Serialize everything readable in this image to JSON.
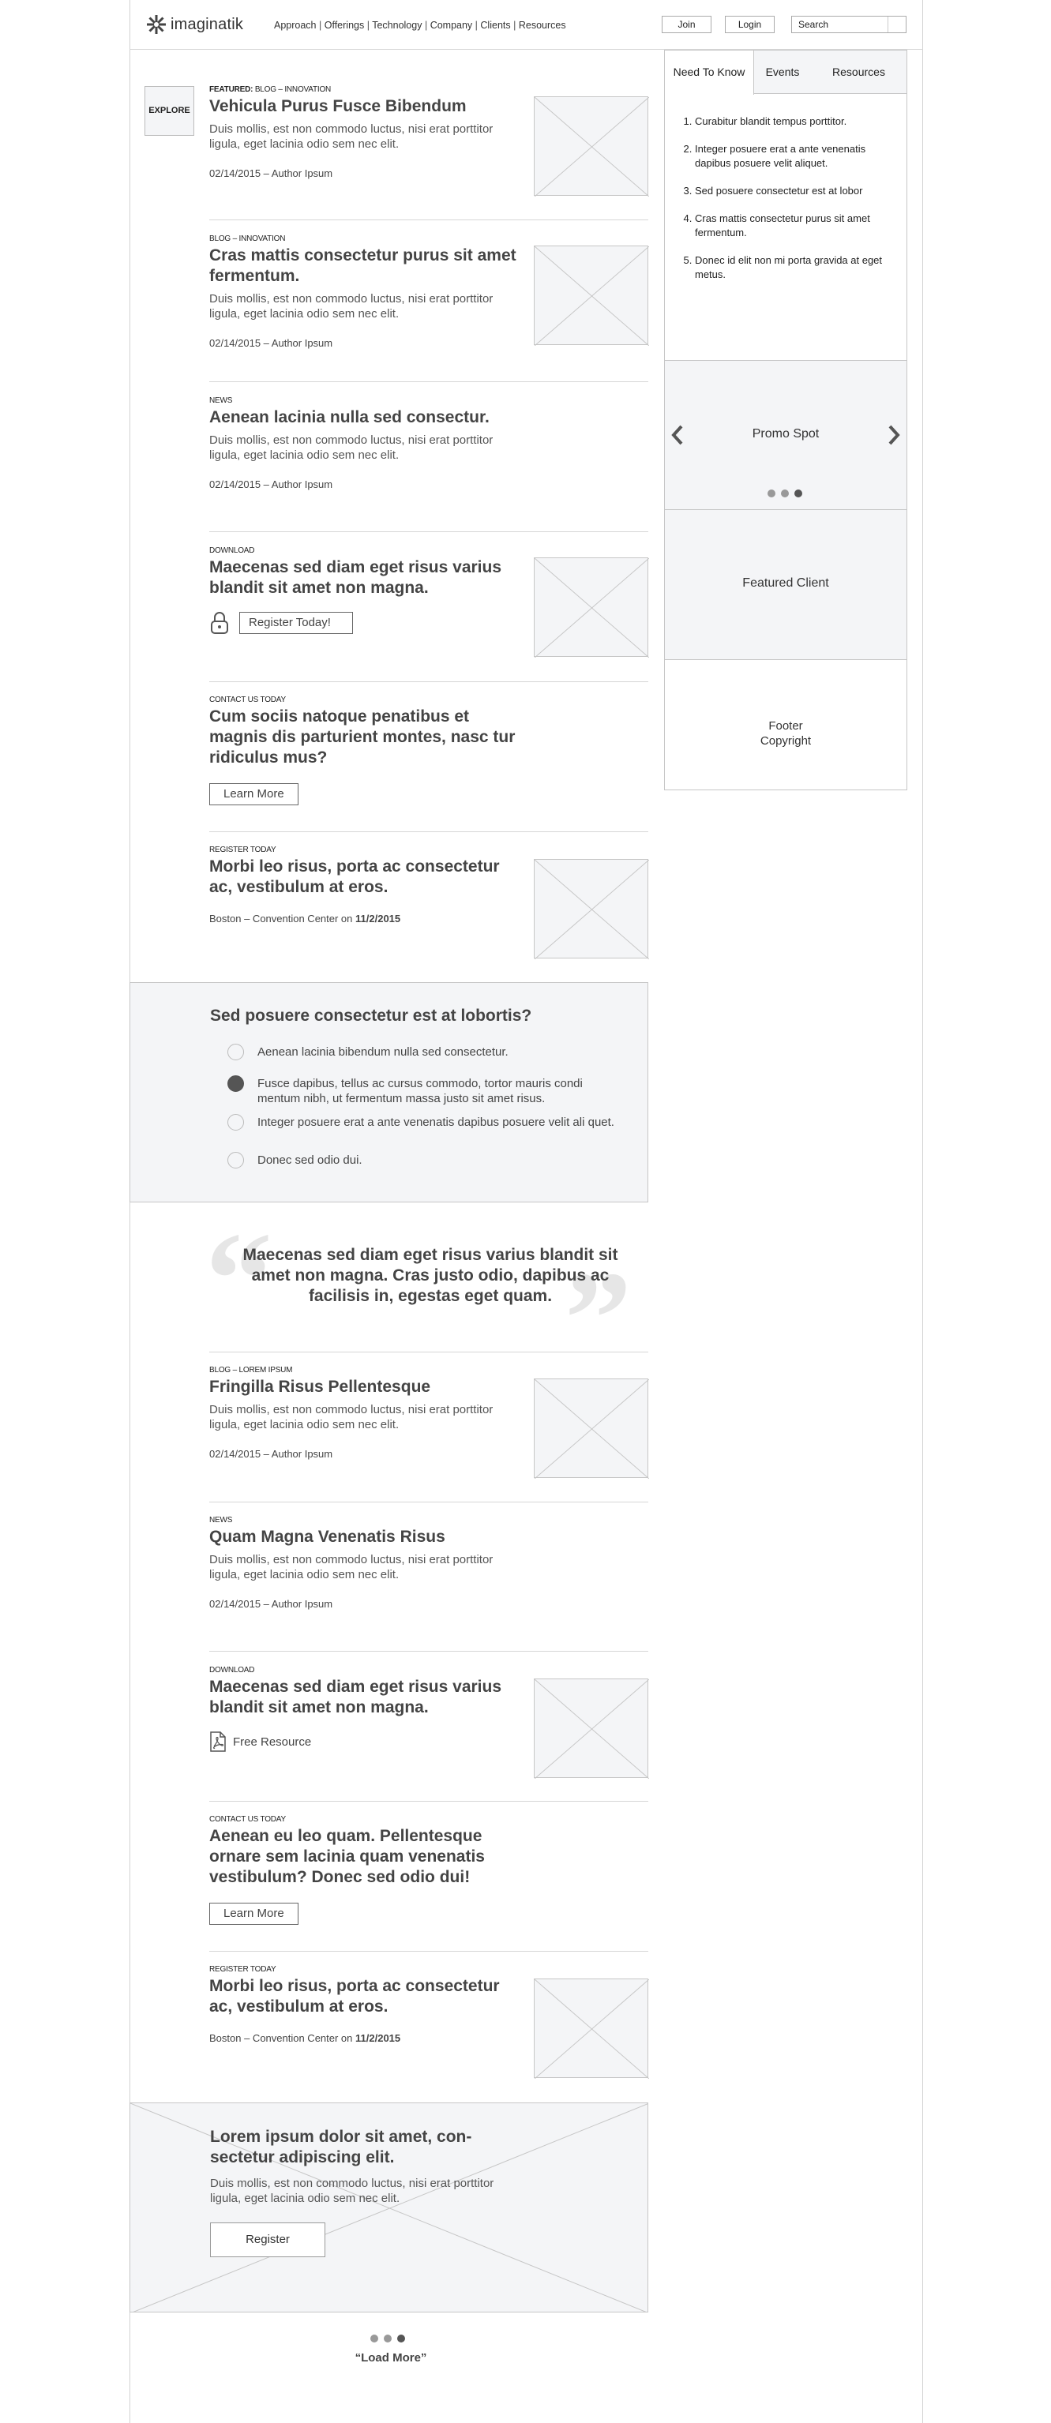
{
  "header": {
    "logo_text": "imaginatik",
    "nav": [
      "Approach",
      "Offerings",
      "Technology",
      "Company",
      "Clients",
      "Resources"
    ],
    "nav_sep": "|",
    "join_label": "Join",
    "login_label": "Login",
    "search_placeholder": "Search"
  },
  "explore_label": "EXPLORE",
  "articles": [
    {
      "tag_bold": "FEATURED:",
      "tag": "BLOG – INNOVATION",
      "title": "Vehicula Purus Fusce Bibendum",
      "excerpt": "Duis mollis, est non commodo luctus, nisi erat porttitor ligula, eget lacinia odio sem nec elit.",
      "meta": "02/14/2015 –  Author Ipsum"
    },
    {
      "tag": "BLOG – INNOVATION",
      "title": "Cras mattis consectetur purus sit amet fermentum.",
      "excerpt": "Duis mollis, est non commodo luctus, nisi erat porttitor ligula, eget lacinia odio sem nec elit.",
      "meta": "02/14/2015 –  Author Ipsum"
    },
    {
      "tag": "NEWS",
      "title": "Aenean lacinia nulla sed consectur.",
      "excerpt": "Duis mollis, est non commodo luctus, nisi erat porttitor ligula, eget lacinia odio sem nec elit.",
      "meta": "02/14/2015 – Author Ipsum"
    },
    {
      "tag": "DOWNLOAD",
      "title": "Maecenas sed diam eget risus varius blandit sit amet non magna.",
      "button": "Register Today!"
    },
    {
      "tag": "CONTACT US TODAY",
      "title": "Cum sociis natoque penatibus et magnis dis parturient montes, nasc tur ridiculus mus?",
      "button": "Learn More"
    },
    {
      "tag": "REGISTER TODAY",
      "title": "Morbi leo risus, porta ac consectetur ac, vestibulum at eros.",
      "meta_prefix": "Boston – Convention Center on ",
      "meta_date": "11/2/2015"
    },
    {
      "tag": "BLOG – LOREM IPSUM",
      "title": "Fringilla Risus Pellentesque",
      "excerpt": "Duis mollis, est non commodo luctus, nisi erat porttitor ligula, eget lacinia odio sem nec elit.",
      "meta": "02/14/2015 –  Author Ipsum"
    },
    {
      "tag": "NEWS",
      "title": "Quam Magna Venenatis Risus",
      "excerpt": "Duis mollis, est non commodo luctus, nisi erat porttitor ligula, eget lacinia odio sem nec elit.",
      "meta": "02/14/2015 – Author Ipsum"
    },
    {
      "tag": "DOWNLOAD",
      "title": "Maecenas sed diam eget risus varius blandit sit amet non magna.",
      "link": "Free Resource"
    },
    {
      "tag": "CONTACT US TODAY",
      "title": "Aenean eu leo quam. Pellentesque ornare sem lacinia quam venenatis vestibulum? Donec sed odio dui!",
      "button": "Learn More"
    },
    {
      "tag": "REGISTER TODAY",
      "title": "Morbi leo risus, porta ac consectetur ac, vestibulum at eros.",
      "meta_prefix": "Boston – Convention Center on ",
      "meta_date": "11/2/2015"
    }
  ],
  "poll": {
    "question": "Sed posuere consectetur est at lobortis?",
    "options": [
      "Aenean lacinia bibendum nulla sed consectetur.",
      "Fusce dapibus, tellus ac cursus commodo, tortor mauris condi mentum nibh, ut fermentum massa justo sit amet risus.",
      "Integer posuere erat a ante venenatis dapibus posuere velit ali quet.",
      "Donec sed odio dui."
    ],
    "selected_index": 1
  },
  "quote": {
    "text": "Maecenas sed diam eget risus varius blandit sit amet non magna. Cras justo odio, dapibus ac facilisis in, egestas eget quam."
  },
  "sidebar": {
    "tabs": [
      "Need To Know",
      "Events",
      "Resources"
    ],
    "active_tab": 0,
    "items": [
      "Curabitur blandit tempus porttitor.",
      "Integer posuere erat a ante venenatis dapibus posuere velit aliquet.",
      "Sed posuere consectetur est at lobor",
      "Cras mattis consectetur purus sit amet fermentum.",
      "Donec id elit non mi porta gravida at eget metus."
    ],
    "promo_label": "Promo Spot",
    "promo_active_dot": 2,
    "featured_label": "Featured Client",
    "footer_line1": "Footer",
    "footer_line2": "Copyright"
  },
  "cta": {
    "title": "Lorem ipsum dolor sit amet, con- sectetur adipiscing elit.",
    "excerpt": "Duis mollis, est non commodo luctus, nisi erat porttitor ligula, eget lacinia odio sem nec elit.",
    "button": "Register"
  },
  "load_more": {
    "label": "“Load More”",
    "active_dot": 2
  },
  "colors": {
    "panel_bg": "#f4f5f7",
    "border": "#c6c6c6",
    "text": "#444444"
  }
}
